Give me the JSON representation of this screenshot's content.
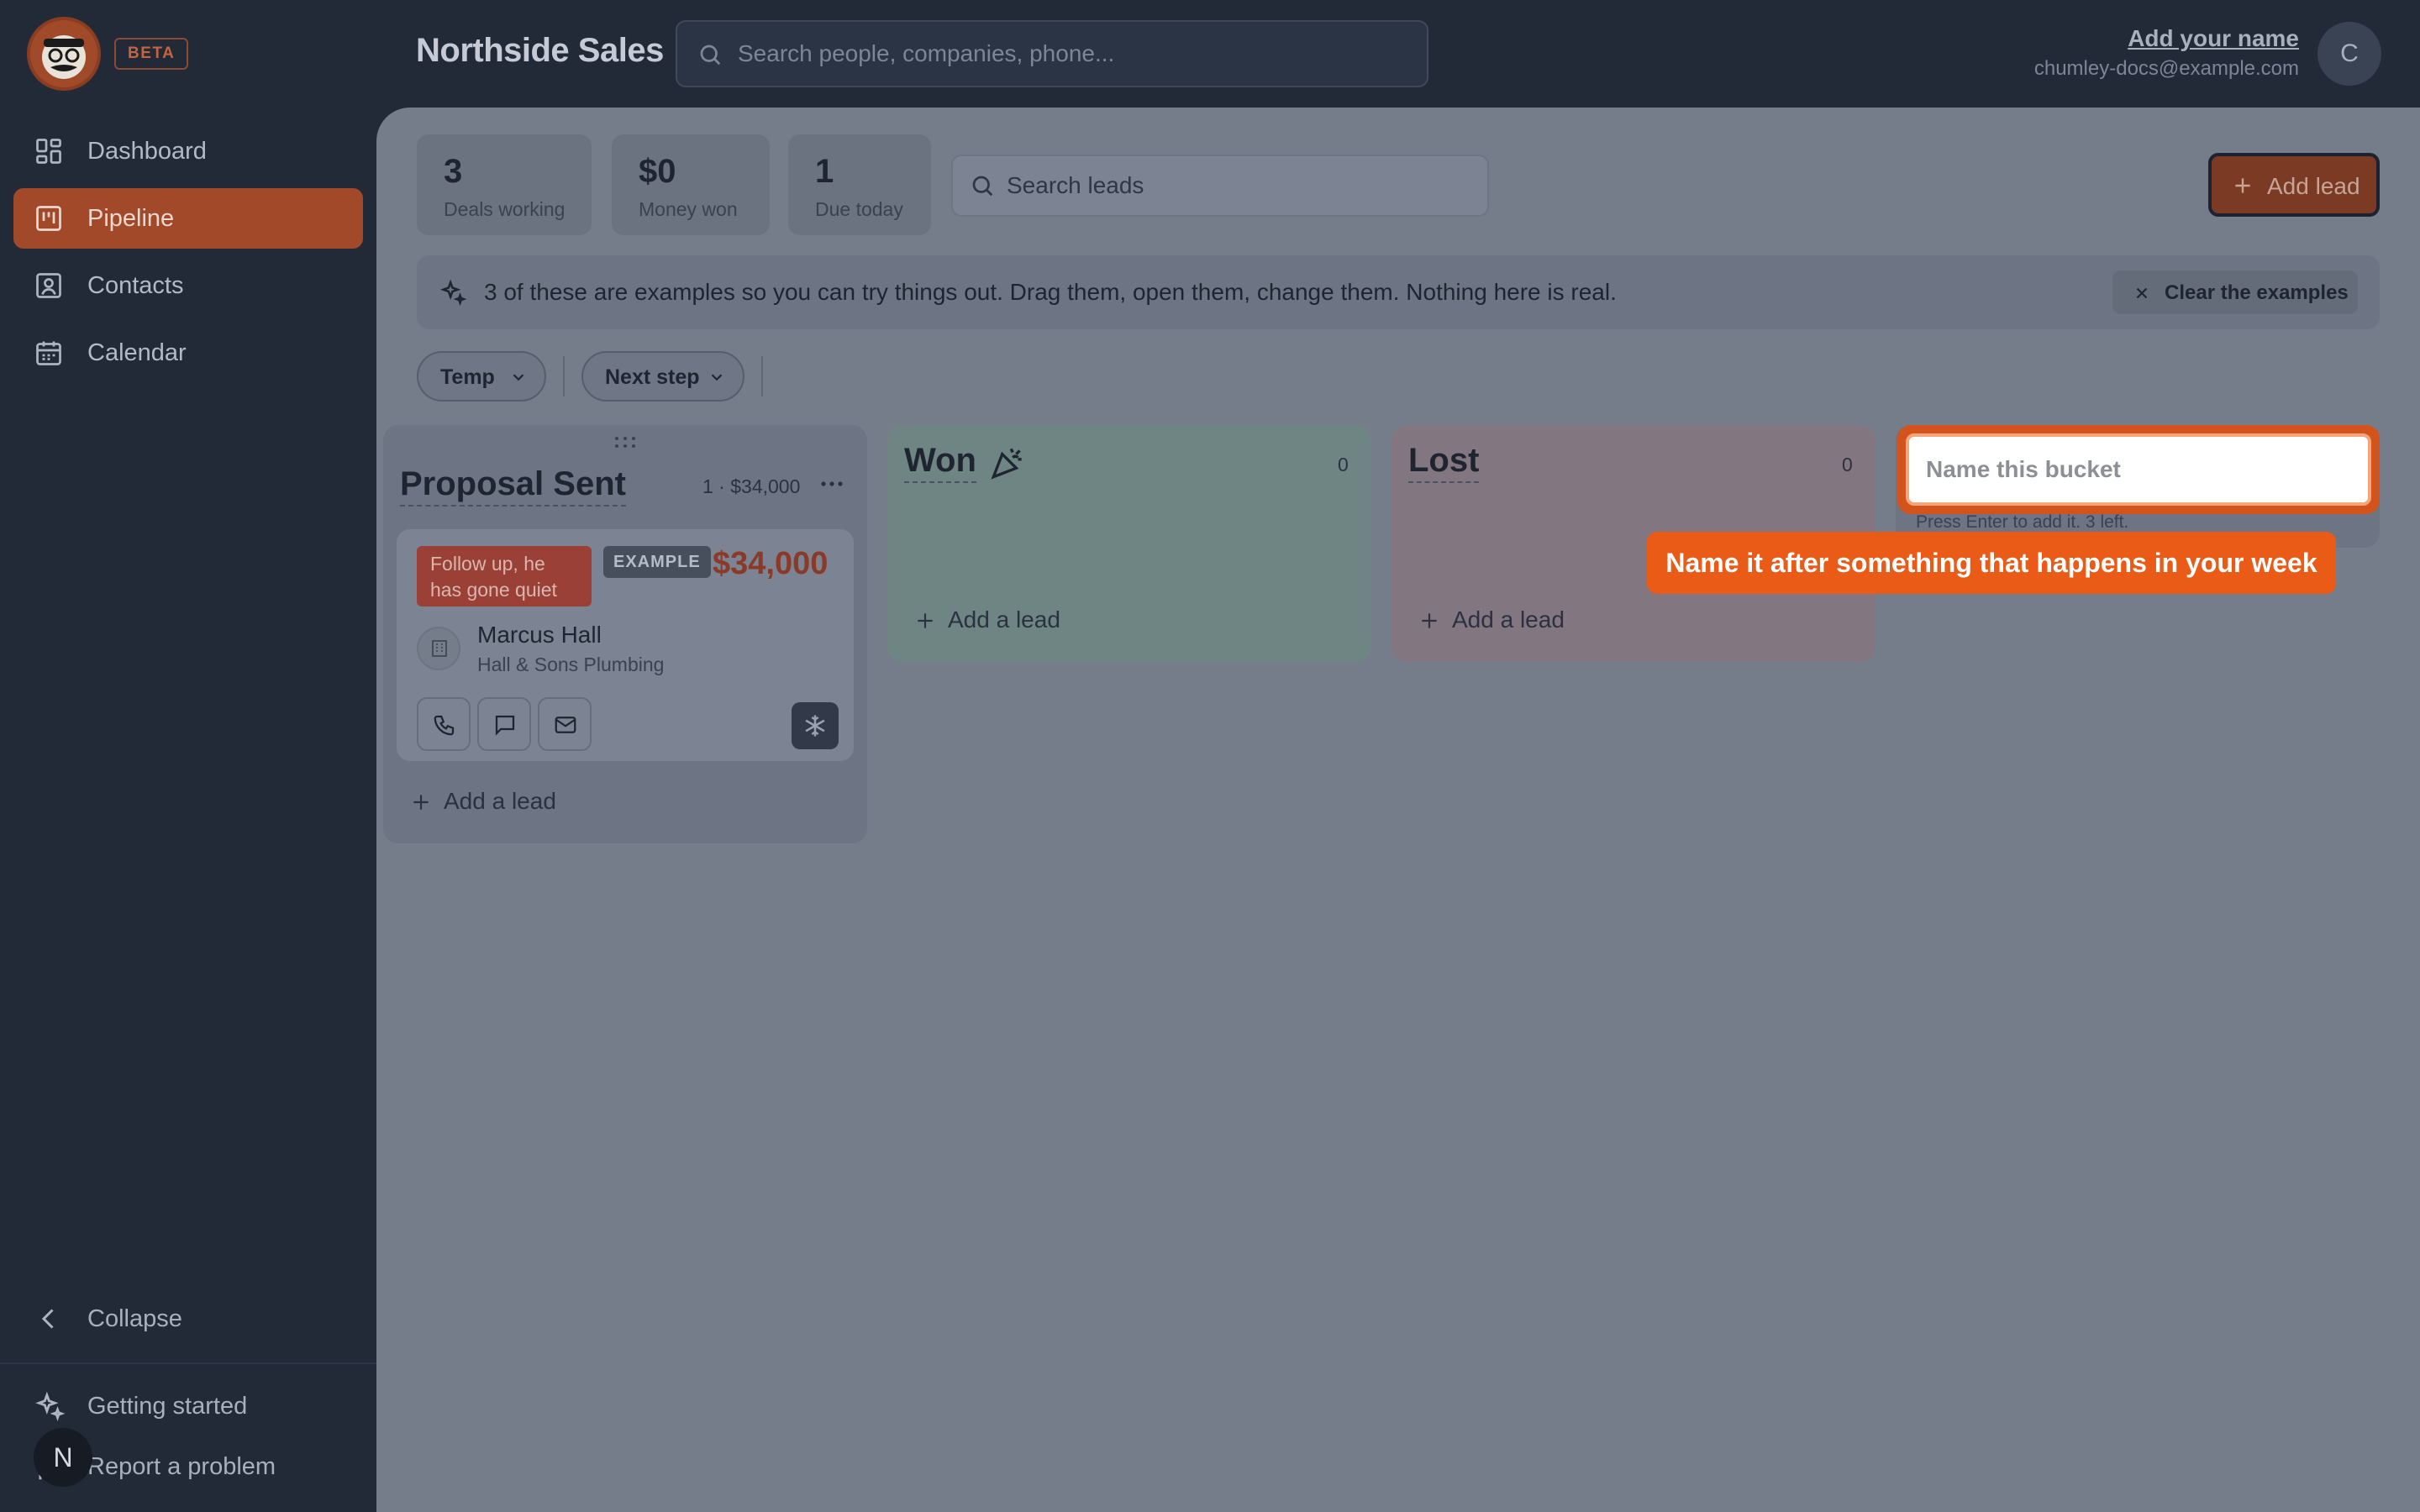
{
  "brand": {
    "beta_label": "BETA"
  },
  "header": {
    "org_title": "Northside Sales",
    "search_placeholder": "Search people, companies, phone...",
    "user_name": "Add your name",
    "user_email": "chumley-docs@example.com",
    "avatar_initial": "C"
  },
  "sidebar": {
    "items": [
      {
        "label": "Dashboard",
        "icon": "dashboard-icon",
        "active": false
      },
      {
        "label": "Pipeline",
        "icon": "pipeline-icon",
        "active": true
      },
      {
        "label": "Contacts",
        "icon": "contacts-icon",
        "active": false
      },
      {
        "label": "Calendar",
        "icon": "calendar-icon",
        "active": false
      }
    ],
    "collapse_label": "Collapse",
    "getting_started_label": "Getting started",
    "report_label": "Report a problem",
    "n_badge": "N"
  },
  "stats": [
    {
      "value": "3",
      "label": "Deals working"
    },
    {
      "value": "$0",
      "label": "Money won"
    },
    {
      "value": "1",
      "label": "Due today"
    }
  ],
  "lead_search_placeholder": "Search leads",
  "add_lead_label": "Add lead",
  "banner": {
    "text": "3 of these are examples so you can try things out. Drag them, open them, change them. Nothing here is real.",
    "clear_label": "Clear the examples"
  },
  "filters": {
    "temp_label": "Temp",
    "next_step_label": "Next step"
  },
  "columns": {
    "proposal": {
      "title": "Proposal Sent",
      "meta": "1 · $34,000",
      "add_label": "Add a lead",
      "card": {
        "tag": "Follow up, he has gone quiet",
        "badge": "EXAMPLE",
        "amount": "$34,000",
        "person": "Marcus Hall",
        "company": "Hall & Sons Plumbing"
      }
    },
    "won": {
      "title": "Won",
      "count": "0",
      "add_label": "Add a lead"
    },
    "lost": {
      "title": "Lost",
      "count": "0",
      "add_label": "Add a lead"
    }
  },
  "new_bucket": {
    "placeholder": "Name this bucket",
    "hint": "Press Enter to add it. 3 left.",
    "tooltip": "Name it after something that happens in your week"
  },
  "colors": {
    "accent": "#a2492a",
    "tooltip": "#e95b16",
    "sidebar_bg": "#222a38",
    "overlay_main": "#757c8a"
  }
}
